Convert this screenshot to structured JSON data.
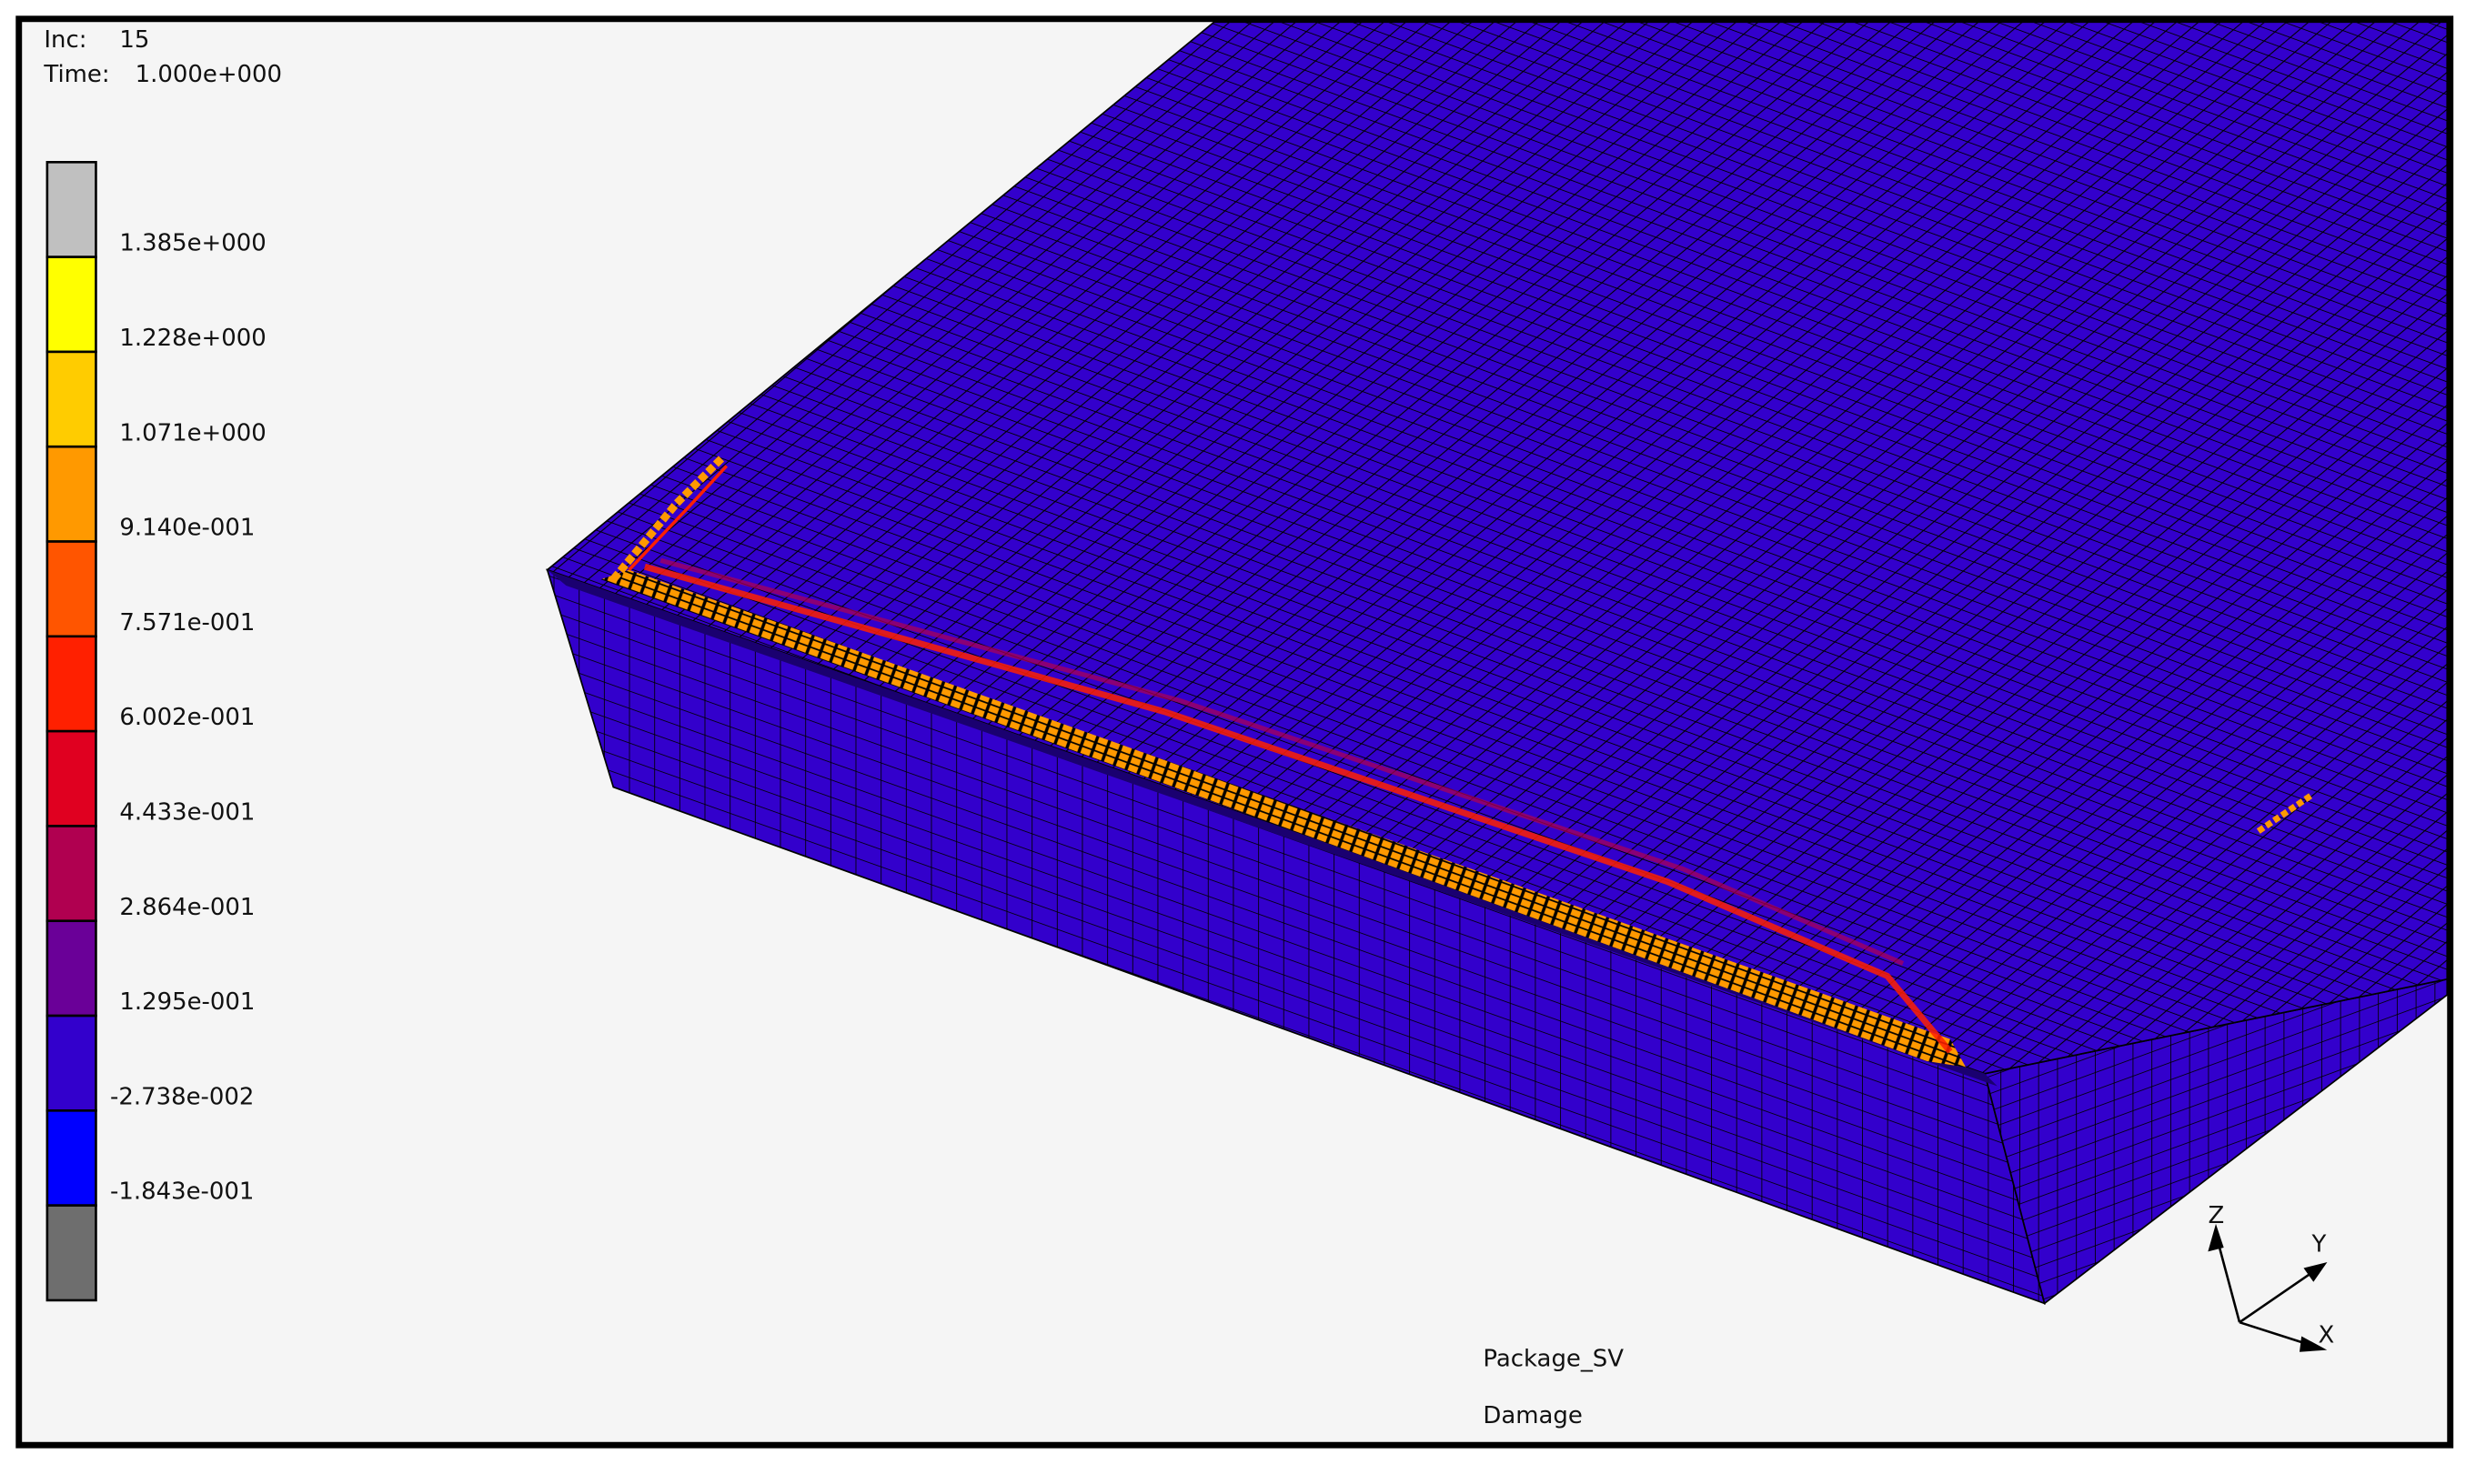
{
  "header": {
    "inc_label": "Inc:",
    "inc_value": "15",
    "time_label": "Time:",
    "time_value": "1.000e+000"
  },
  "legend": {
    "colors": [
      "#c0c0c0",
      "#ffff00",
      "#ffcc00",
      "#ff9900",
      "#ff5500",
      "#ff2000",
      "#e00020",
      "#b00050",
      "#6a0098",
      "#3300cc",
      "#0000ff",
      "#6e6e6e"
    ],
    "labels": [
      "1.385e+000",
      "1.228e+000",
      "1.071e+000",
      "9.140e-001",
      "7.571e-001",
      "6.002e-001",
      "4.433e-001",
      "2.864e-001",
      "1.295e-001",
      "-2.738e-002",
      "-1.843e-001"
    ]
  },
  "model": {
    "name": "Package_SV",
    "result": "Damage",
    "mesh_color": "#3300cc"
  },
  "triad": {
    "x": "X",
    "y": "Y",
    "z": "Z"
  }
}
